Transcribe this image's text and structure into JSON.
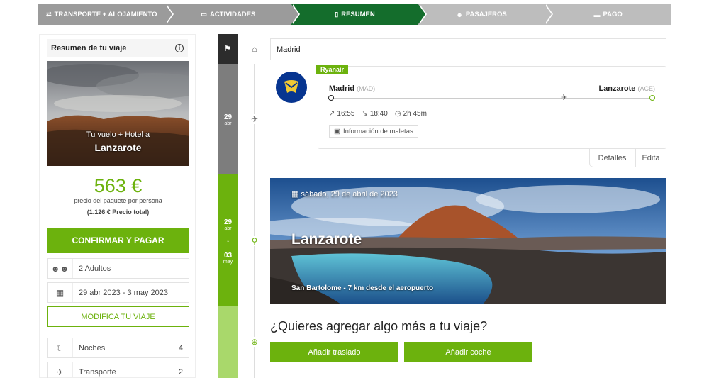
{
  "stepper": {
    "steps": [
      {
        "label": "Transporte + Alojamiento",
        "icon": "transport-icon"
      },
      {
        "label": "Actividades",
        "icon": "ticket-icon"
      },
      {
        "label": "Resumen",
        "icon": "document-icon"
      },
      {
        "label": "Pasajeros",
        "icon": "people-icon"
      },
      {
        "label": "Pago",
        "icon": "card-icon"
      }
    ],
    "active_index": 2
  },
  "summary": {
    "title": "Resumen de tu viaje",
    "hero_subtitle": "Tu vuelo + Hotel a",
    "hero_title": "Lanzarote",
    "price": "563 €",
    "price_label": "precio del paquete por persona",
    "price_total": "(1.126 € Precio total)",
    "confirm_label": "Confirmar y pagar",
    "travellers": "2 Adultos",
    "dates": "29 abr 2023 - 3 may 2023",
    "modify_label": "Modifica tu viaje",
    "nights_label": "Noches",
    "nights_value": "4",
    "transport_label": "Transporte",
    "transport_value": "2"
  },
  "timeline": {
    "date1_day": "29",
    "date1_month": "abr",
    "date2_day": "29",
    "date2_month": "abr",
    "date3_day": "03",
    "date3_month": "may",
    "arrow": "↓"
  },
  "origin": "Madrid",
  "flight": {
    "airline": "Ryanair",
    "from_city": "Madrid",
    "from_code": "(MAD)",
    "to_city": "Lanzarote",
    "to_code": "(ACE)",
    "depart": "16:55",
    "arrive": "18:40",
    "duration": "2h 45m",
    "baggage_label": "Información de maletas",
    "details_label": "Detalles",
    "edit_label": "Edita"
  },
  "destination": {
    "date": "sábado, 29 de abril de 2023",
    "title": "Lanzarote",
    "subtitle": "San Bartolome - 7 km desde el aeropuerto"
  },
  "extras": {
    "question": "¿Quieres agregar algo más a tu viaje?",
    "transfer_label": "Añadir traslado",
    "car_label": "Añadir coche"
  },
  "colors": {
    "accent_green": "#6cb20d",
    "dark_green": "#146d2c",
    "ryanair_blue": "#073590"
  }
}
